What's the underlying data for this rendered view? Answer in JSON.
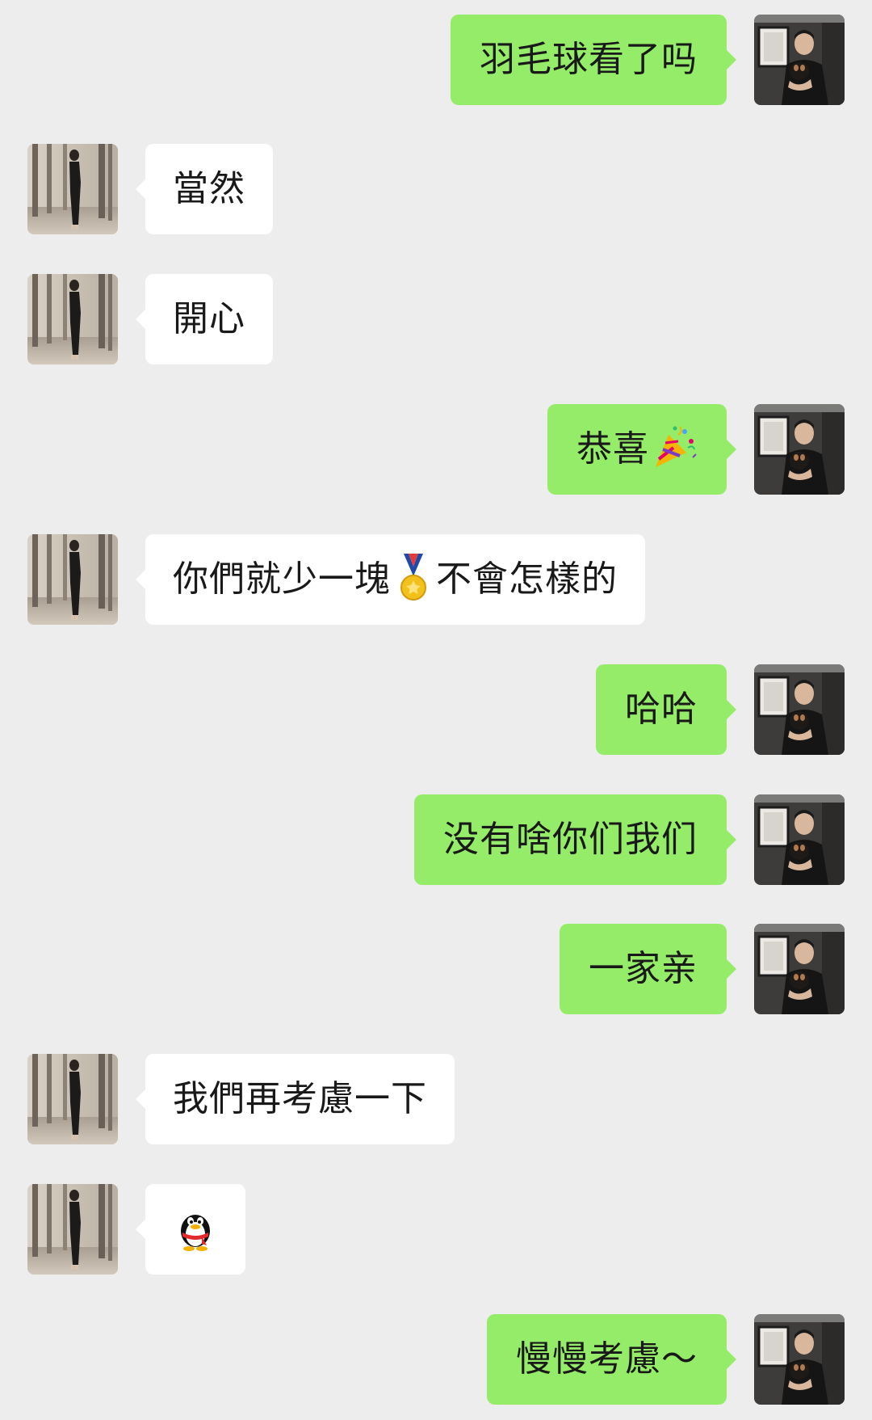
{
  "chat": {
    "messages": [
      {
        "side": "right",
        "text": "羽毛球看了吗"
      },
      {
        "side": "left",
        "text": "當然"
      },
      {
        "side": "left",
        "text": "開心"
      },
      {
        "side": "right",
        "text": "恭喜",
        "emoji_after": "party-popper-icon"
      },
      {
        "side": "left",
        "text_before": "你們就少一塊",
        "emoji_middle": "gold-medal-icon",
        "text_after": "不會怎樣的"
      },
      {
        "side": "right",
        "text": "哈哈"
      },
      {
        "side": "right",
        "text": "没有啥你们我们"
      },
      {
        "side": "right",
        "text": "一家亲"
      },
      {
        "side": "left",
        "text": "我們再考慮一下"
      },
      {
        "side": "left",
        "sticker": "penguin-icon"
      },
      {
        "side": "right",
        "text": "慢慢考慮～"
      }
    ]
  },
  "colors": {
    "background": "#ededed",
    "outgoing_bubble": "#95ec69",
    "incoming_bubble": "#ffffff",
    "text": "#191919"
  }
}
